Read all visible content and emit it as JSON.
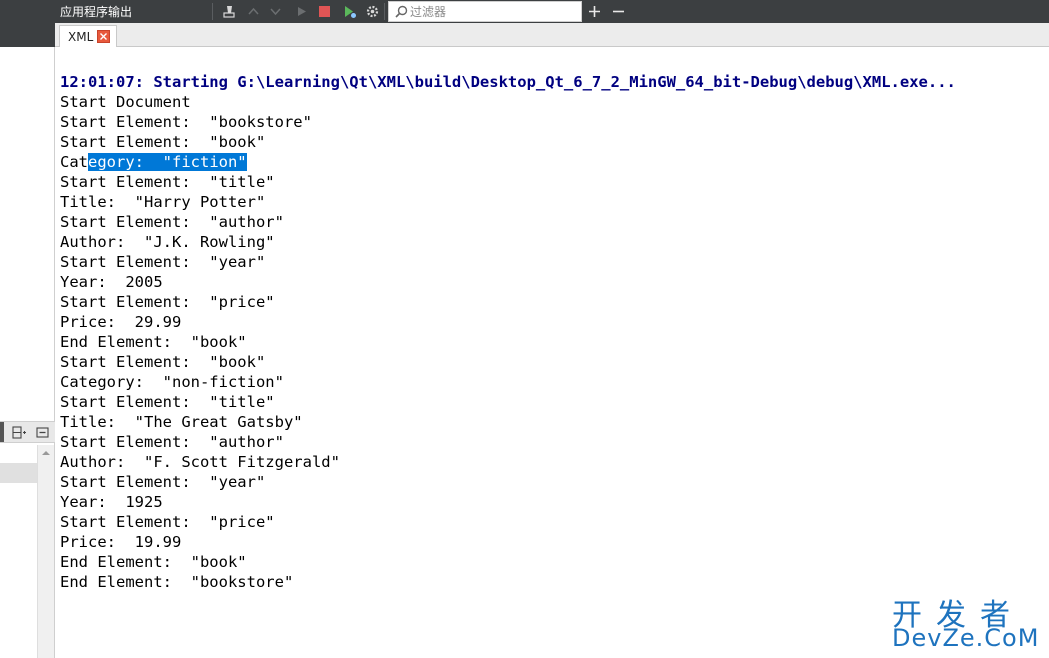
{
  "window": {
    "panel_title": "应用程序输出",
    "filter_placeholder": "过滤器"
  },
  "tabs": [
    {
      "label": "XML"
    }
  ],
  "output": {
    "header": "12:01:07: Starting G:\\Learning\\Qt\\XML\\build\\Desktop_Qt_6_7_2_MinGW_64_bit-Debug\\debug\\XML.exe...",
    "lines": [
      "Start Document",
      "Start Element:  \"bookstore\"",
      "Start Element:  \"book\"",
      "Category:  \"fiction\"",
      "Start Element:  \"title\"",
      "Title:  \"Harry Potter\"",
      "Start Element:  \"author\"",
      "Author:  \"J.K. Rowling\"",
      "Start Element:  \"year\"",
      "Year:  2005",
      "Start Element:  \"price\"",
      "Price:  29.99",
      "End Element:  \"book\"",
      "Start Element:  \"book\"",
      "Category:  \"non-fiction\"",
      "Start Element:  \"title\"",
      "Title:  \"The Great Gatsby\"",
      "Start Element:  \"author\"",
      "Author:  \"F. Scott Fitzgerald\"",
      "Start Element:  \"year\"",
      "Year:  1925",
      "Start Element:  \"price\"",
      "Price:  19.99",
      "End Element:  \"book\"",
      "End Element:  \"bookstore\""
    ],
    "selection": {
      "before": "Cat",
      "selected": "egory:  \"fiction\""
    }
  },
  "watermark": {
    "line1": "开发者",
    "line2": "DevZe.CoM"
  },
  "colors": {
    "toolbar_bg": "#3c3f41",
    "header_text": "#000080",
    "selection_bg": "#0078d7",
    "watermark": "#1e73be"
  }
}
